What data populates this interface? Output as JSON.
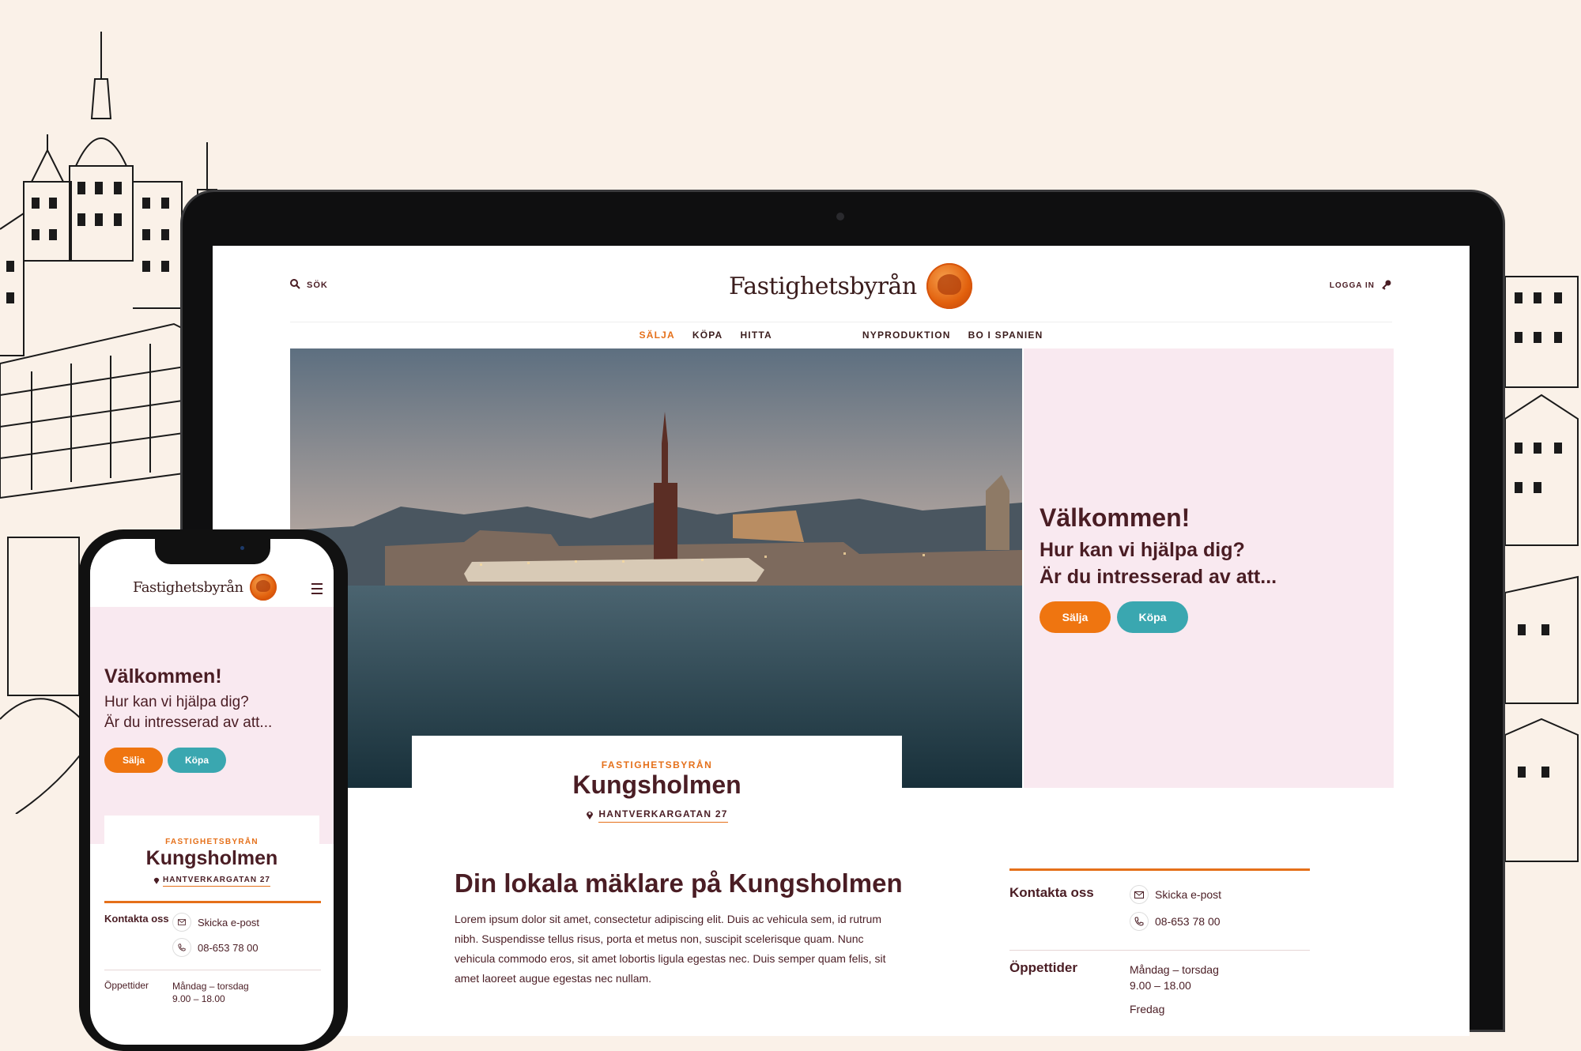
{
  "colors": {
    "background": "#faf1e8",
    "accent_orange": "#ef7510",
    "accent_teal": "#3aa7b0",
    "brand_text": "#4a1d24",
    "hero_panel": "#f9e9f0"
  },
  "header": {
    "search_label": "SÖK",
    "search_icon": "search-icon",
    "logo_text": "Fastighetsbyrån",
    "login_label": "LOGGA IN",
    "login_icon": "key-icon"
  },
  "nav": {
    "items": [
      {
        "label": "SÄLJA",
        "active": true
      },
      {
        "label": "KÖPA",
        "active": false
      },
      {
        "label": "HITTA",
        "active": false
      },
      {
        "label": "NYPRODUKTION",
        "active": false
      },
      {
        "label": "BO I SPANIEN",
        "active": false
      }
    ]
  },
  "hero": {
    "title": "Välkommen!",
    "subtitle_line1": "Hur kan vi hjälpa dig?",
    "subtitle_line2": "Är du intresserad av att...",
    "sell_button": "Sälja",
    "buy_button": "Köpa"
  },
  "office": {
    "kicker": "FASTIGHETSBYRÅN",
    "name": "Kungsholmen",
    "address": "HANTVERKARGATAN 27"
  },
  "intro": {
    "title": "Din lokala mäklare på Kungsholmen",
    "text": "Lorem ipsum dolor sit amet, consectetur adipiscing elit. Duis ac vehicula sem, id rutrum nibh. Suspendisse tellus risus, porta et metus non, suscipit scelerisque quam. Nunc vehicula commodo eros, sit amet lobortis ligula egestas nec. Duis semper quam felis, sit amet laoreet augue egestas nec nullam."
  },
  "contact": {
    "label": "Kontakta oss",
    "email_label": "Skicka e-post",
    "phone": "08-653 78 00",
    "hours_label": "Öppettider",
    "hours_days": "Måndag – torsdag",
    "hours_time": "9.00 – 18.00",
    "friday": "Fredag"
  }
}
